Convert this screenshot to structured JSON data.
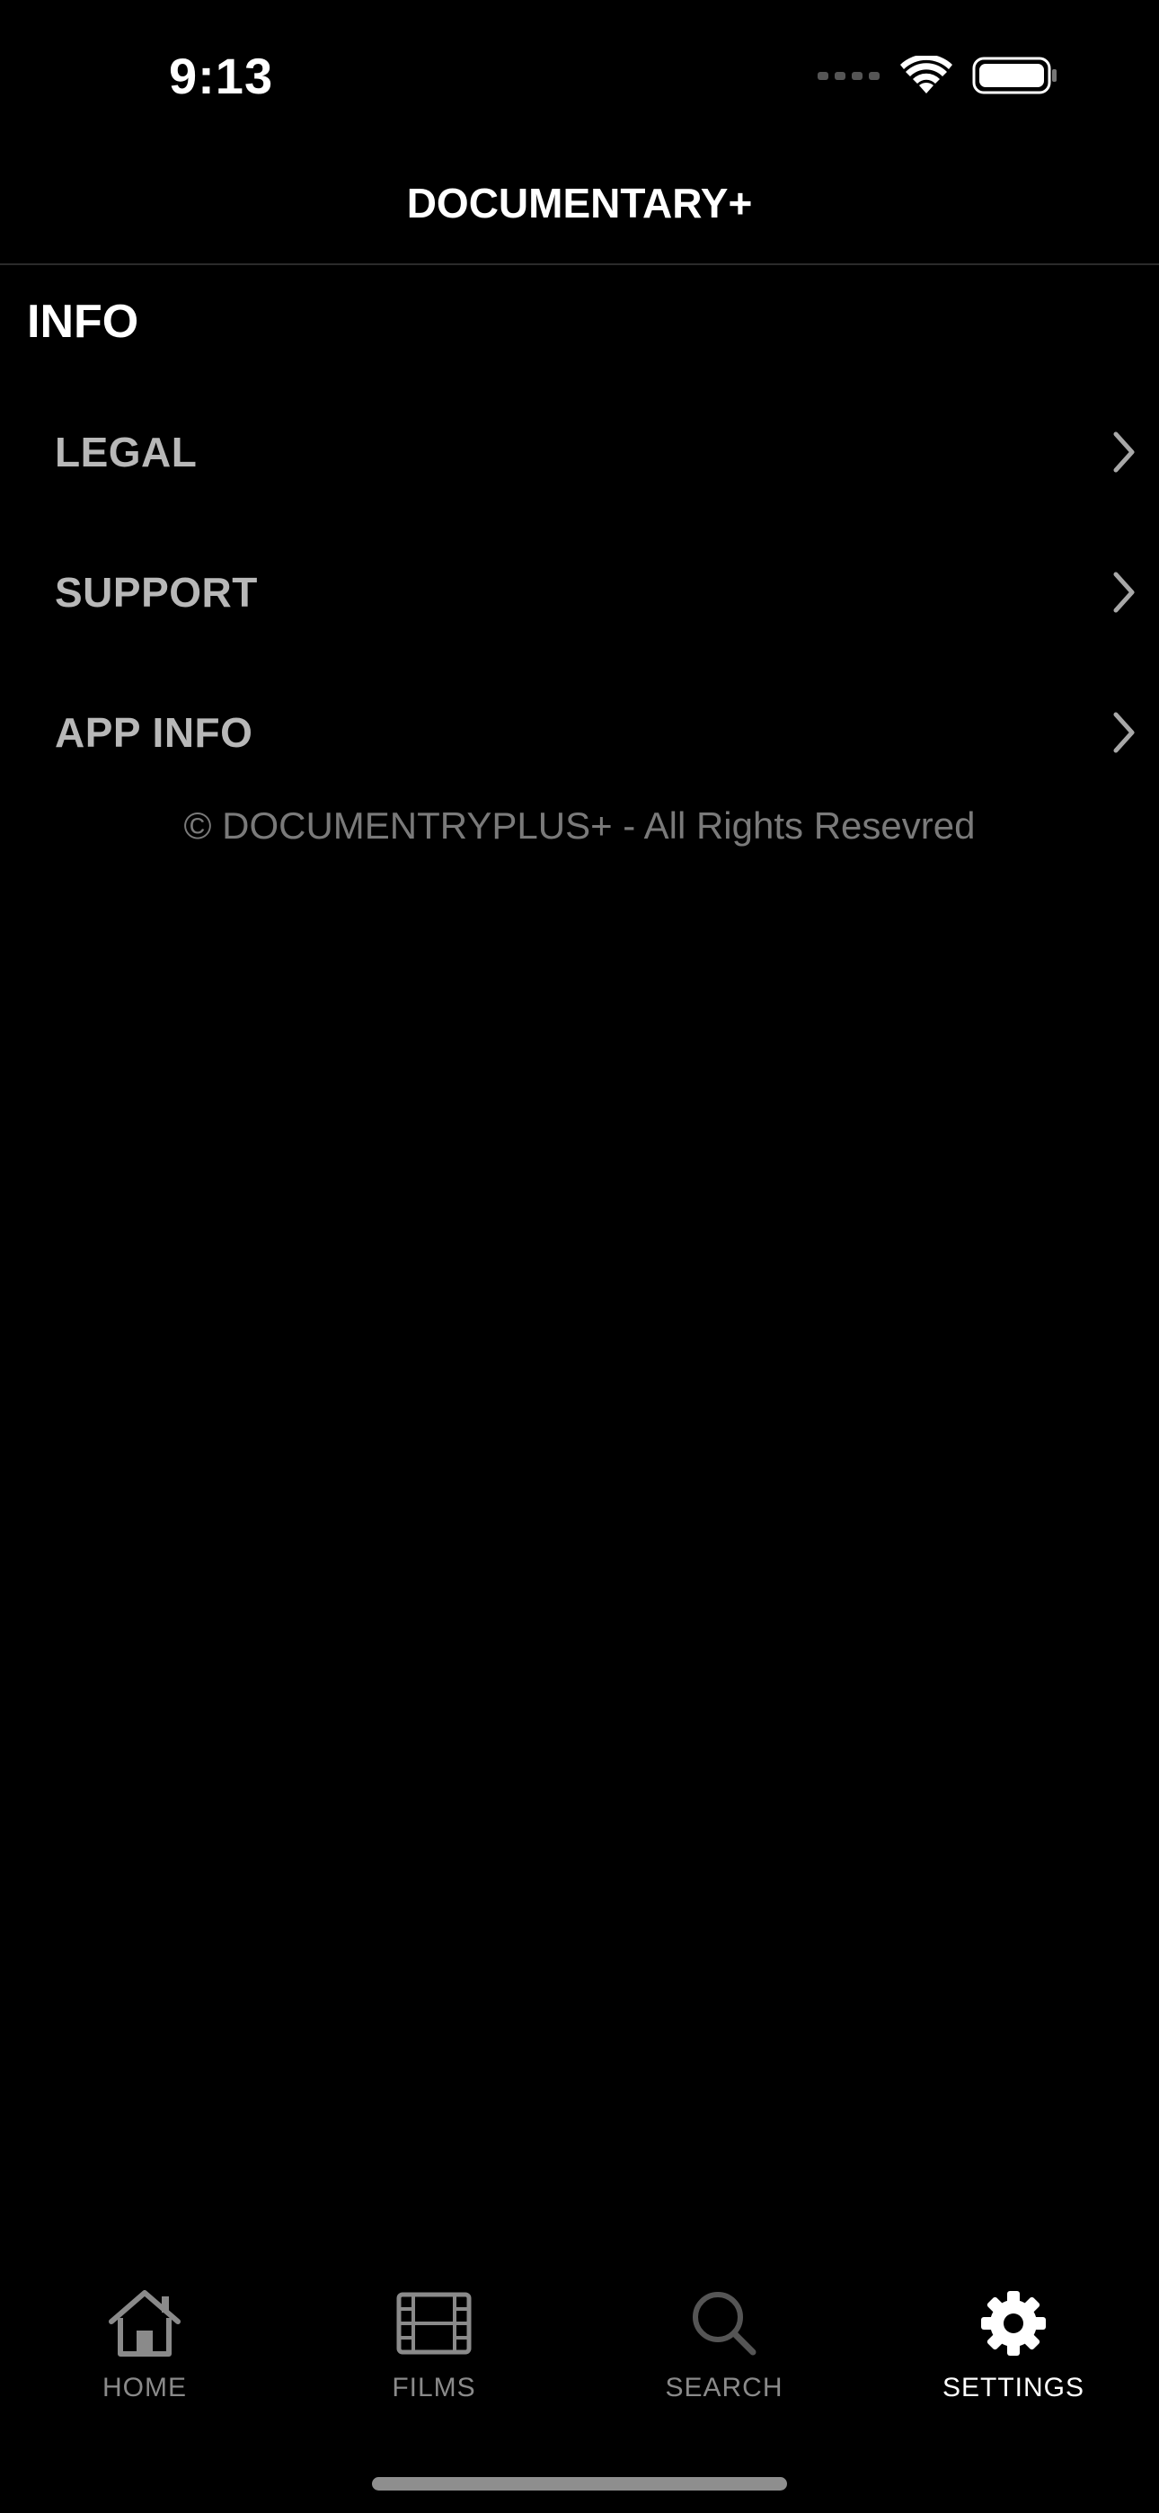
{
  "status_bar": {
    "time": "9:13"
  },
  "header": {
    "title": "DOCUMENTARY+"
  },
  "section": {
    "title": "INFO",
    "items": [
      {
        "label": "LEGAL",
        "icon": "chevron-right-icon"
      },
      {
        "label": "SUPPORT",
        "icon": "chevron-right-icon"
      },
      {
        "label": "APP INFO",
        "icon": "chevron-right-icon"
      }
    ],
    "footer": "© DOCUMENTRYPLUS+ - All Rights Resevred"
  },
  "tab_bar": {
    "tabs": [
      {
        "label": "HOME",
        "icon": "home-icon",
        "active": false
      },
      {
        "label": "FILMS",
        "icon": "film-icon",
        "active": false
      },
      {
        "label": "SEARCH",
        "icon": "search-icon",
        "active": false
      },
      {
        "label": "SETTINGS",
        "icon": "gear-icon",
        "active": true
      }
    ]
  },
  "colors": {
    "background": "#000000",
    "active_tab": "#ffffff",
    "inactive_tab": "#8a8a8a",
    "menu_label": "#b8b8b8",
    "footer_text": "#7a7a7a"
  }
}
